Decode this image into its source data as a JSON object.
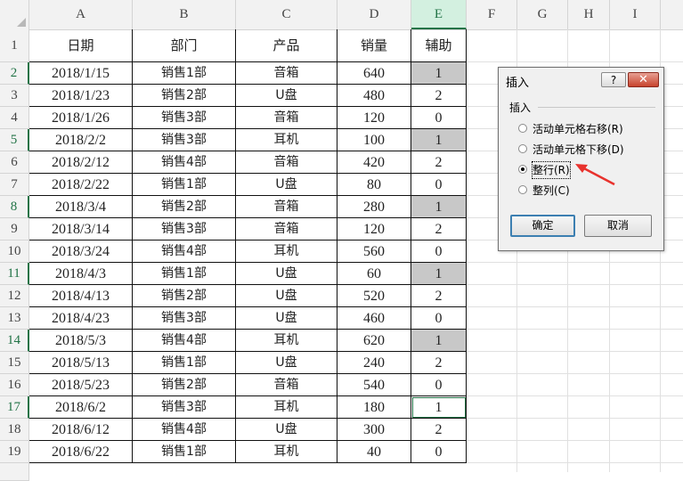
{
  "columns": [
    "A",
    "B",
    "C",
    "D",
    "E",
    "F",
    "G",
    "H",
    "I"
  ],
  "selected_column": "E",
  "header_row": {
    "A": "日期",
    "B": "部门",
    "C": "产品",
    "D": "销量",
    "E": "辅助"
  },
  "rows": [
    {
      "n": "2",
      "date": "2018/1/15",
      "dept": "销售1部",
      "prod": "音箱",
      "qty": "640",
      "aux": "1"
    },
    {
      "n": "3",
      "date": "2018/1/23",
      "dept": "销售2部",
      "prod": "U盘",
      "qty": "480",
      "aux": "2"
    },
    {
      "n": "4",
      "date": "2018/1/26",
      "dept": "销售3部",
      "prod": "音箱",
      "qty": "120",
      "aux": "0"
    },
    {
      "n": "5",
      "date": "2018/2/2",
      "dept": "销售3部",
      "prod": "耳机",
      "qty": "100",
      "aux": "1"
    },
    {
      "n": "6",
      "date": "2018/2/12",
      "dept": "销售4部",
      "prod": "音箱",
      "qty": "420",
      "aux": "2"
    },
    {
      "n": "7",
      "date": "2018/2/22",
      "dept": "销售1部",
      "prod": "U盘",
      "qty": "80",
      "aux": "0"
    },
    {
      "n": "8",
      "date": "2018/3/4",
      "dept": "销售2部",
      "prod": "音箱",
      "qty": "280",
      "aux": "1"
    },
    {
      "n": "9",
      "date": "2018/3/14",
      "dept": "销售3部",
      "prod": "音箱",
      "qty": "120",
      "aux": "2"
    },
    {
      "n": "10",
      "date": "2018/3/24",
      "dept": "销售4部",
      "prod": "耳机",
      "qty": "560",
      "aux": "0"
    },
    {
      "n": "11",
      "date": "2018/4/3",
      "dept": "销售1部",
      "prod": "U盘",
      "qty": "60",
      "aux": "1"
    },
    {
      "n": "12",
      "date": "2018/4/13",
      "dept": "销售2部",
      "prod": "U盘",
      "qty": "520",
      "aux": "2"
    },
    {
      "n": "13",
      "date": "2018/4/23",
      "dept": "销售3部",
      "prod": "U盘",
      "qty": "460",
      "aux": "0"
    },
    {
      "n": "14",
      "date": "2018/5/3",
      "dept": "销售4部",
      "prod": "耳机",
      "qty": "620",
      "aux": "1"
    },
    {
      "n": "15",
      "date": "2018/5/13",
      "dept": "销售1部",
      "prod": "U盘",
      "qty": "240",
      "aux": "2"
    },
    {
      "n": "16",
      "date": "2018/5/23",
      "dept": "销售2部",
      "prod": "音箱",
      "qty": "540",
      "aux": "0"
    },
    {
      "n": "17",
      "date": "2018/6/2",
      "dept": "销售3部",
      "prod": "耳机",
      "qty": "180",
      "aux": "1"
    },
    {
      "n": "18",
      "date": "2018/6/12",
      "dept": "销售4部",
      "prod": "U盘",
      "qty": "300",
      "aux": "2"
    },
    {
      "n": "19",
      "date": "2018/6/22",
      "dept": "销售1部",
      "prod": "耳机",
      "qty": "40",
      "aux": "0"
    }
  ],
  "colors": {
    "selection_green": "#217346",
    "highlight_gray": "#c8c8c8",
    "arrow_red": "#e8322d"
  },
  "dialog": {
    "title": "插入",
    "help_label": "?",
    "close_label": "✕",
    "group_label": "插入",
    "options": [
      {
        "label": "活动单元格右移(R)",
        "checked": false
      },
      {
        "label": "活动单元格下移(D)",
        "checked": false
      },
      {
        "label": "整行(R)",
        "checked": true
      },
      {
        "label": "整列(C)",
        "checked": false
      }
    ],
    "ok_label": "确定",
    "cancel_label": "取消"
  }
}
